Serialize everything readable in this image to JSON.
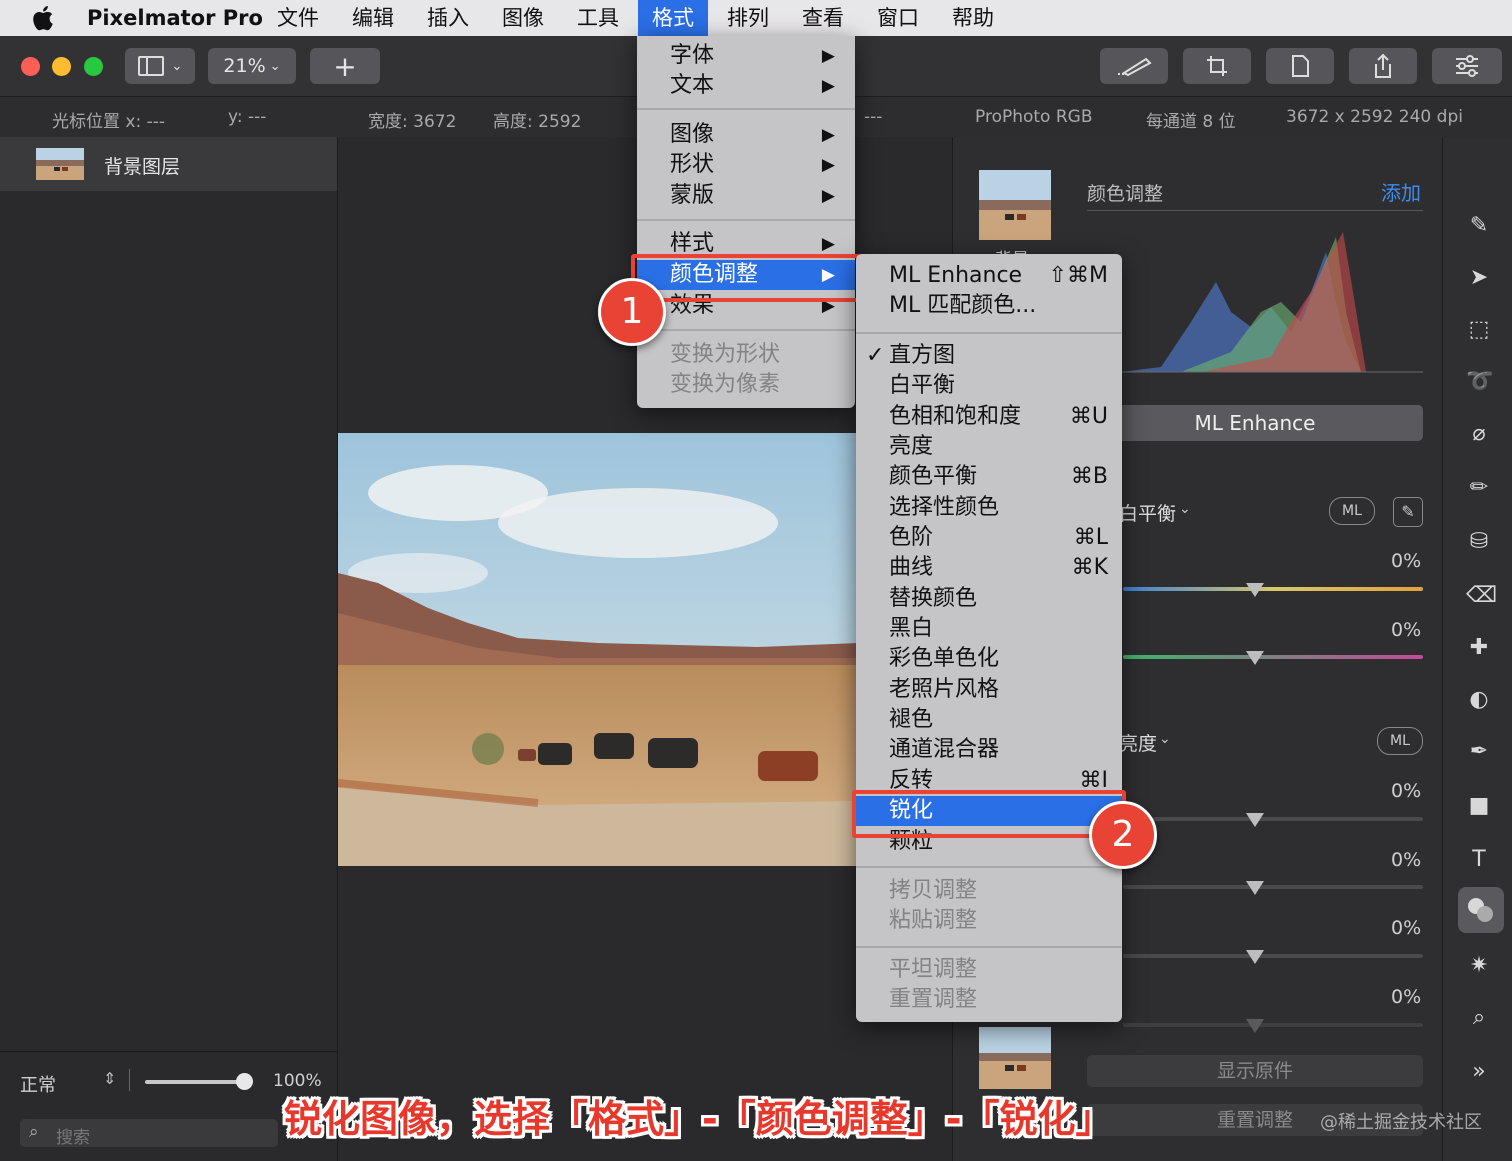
{
  "menubar": {
    "app_name": "Pixelmator Pro",
    "items": [
      "文件",
      "编辑",
      "插入",
      "图像",
      "工具",
      "格式",
      "排列",
      "查看",
      "窗口",
      "帮助"
    ],
    "active_item": "格式"
  },
  "toolbar": {
    "zoom_label": "21%",
    "add_label": "+"
  },
  "infobar": {
    "cursor_x_label": "光标位置 x:  ---",
    "cursor_y_label": "y:  ---",
    "width_label": "宽度:  3672",
    "height_label": "高度:  2592",
    "dash_label": "---",
    "color_profile": "ProPhoto RGB",
    "bit_depth": "每通道 8 位",
    "dimensions_dpi": "3672 x 2592 240 dpi"
  },
  "layers": {
    "layer_name": "背景图层",
    "blend_mode": "正常",
    "opacity": "100%",
    "search_placeholder": "搜索"
  },
  "format_menu": {
    "items": [
      {
        "label": "字体",
        "arrow": "▶"
      },
      {
        "label": "文本",
        "arrow": "▶"
      },
      {
        "label": "图像",
        "arrow": "▶"
      },
      {
        "label": "形状",
        "arrow": "▶"
      },
      {
        "label": "蒙版",
        "arrow": "▶"
      },
      {
        "label": "样式",
        "arrow": "▶"
      },
      {
        "label": "颜色调整",
        "arrow": "▶"
      },
      {
        "label": "效果",
        "arrow": "▶"
      },
      {
        "label": "变换为形状"
      },
      {
        "label": "变换为像素"
      }
    ]
  },
  "color_adjust_menu": {
    "items": [
      {
        "label": "ML Enhance",
        "shortcut": "⇧⌘M"
      },
      {
        "label": "ML 匹配颜色..."
      },
      {
        "label": "直方图",
        "check": "✓"
      },
      {
        "label": "白平衡"
      },
      {
        "label": "色相和饱和度",
        "shortcut": "⌘U"
      },
      {
        "label": "亮度"
      },
      {
        "label": "颜色平衡",
        "shortcut": "⌘B"
      },
      {
        "label": "选择性颜色"
      },
      {
        "label": "色阶",
        "shortcut": "⌘L"
      },
      {
        "label": "曲线",
        "shortcut": "⌘K"
      },
      {
        "label": "替换颜色"
      },
      {
        "label": "黑白"
      },
      {
        "label": "彩色单色化"
      },
      {
        "label": "老照片风格"
      },
      {
        "label": "褪色"
      },
      {
        "label": "通道混合器"
      },
      {
        "label": "反转",
        "shortcut": "⌘I"
      },
      {
        "label": "锐化"
      },
      {
        "label": "颗粒"
      },
      {
        "label": "拷贝调整"
      },
      {
        "label": "粘贴调整"
      },
      {
        "label": "平坦调整"
      },
      {
        "label": "重置调整"
      }
    ]
  },
  "right_panel": {
    "section_title": "颜色调整",
    "add_link": "添加",
    "ml_enhance_button": "ML Enhance",
    "white_balance_label": "白平衡",
    "brightness_label": "亮度",
    "ml_badge": "ML",
    "slider_values": [
      "0%",
      "0%",
      "0%",
      "0%",
      "0%",
      "0%"
    ],
    "show_original": "显示原件",
    "reset_adjust": "重置调整",
    "layer_thumb_text": "背景"
  },
  "annotations": {
    "step1": "1",
    "step2": "2",
    "caption": "锐化图像，选择「格式」-「颜色调整」-「锐化」",
    "watermark": "@稀土掘金技术社区"
  },
  "colors": {
    "menu_highlight": "#2b6fe6",
    "annotation_red": "#e84335",
    "accent_blue": "#3d8cf0"
  }
}
